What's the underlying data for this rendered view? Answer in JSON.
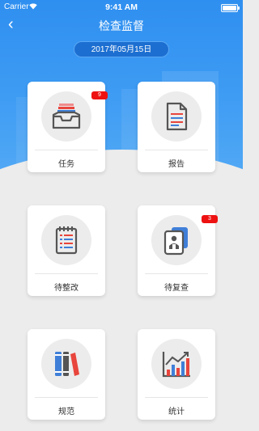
{
  "status_bar": {
    "carrier": "Carrier",
    "wifi_icon": "wifi-icon",
    "time": "9:41 AM",
    "battery_icon": "battery-icon"
  },
  "nav": {
    "back_icon": "chevron-left-icon",
    "back_glyph": "‹",
    "title": "检查监督"
  },
  "date": "2017年05月15日",
  "colors": {
    "header": "#2f8ff0",
    "badge": "#ee1111",
    "accent_red": "#e8453c",
    "accent_blue": "#3f7fd8"
  },
  "cards": [
    {
      "label": "任务",
      "badge": "9",
      "icon": "inbox-tray-icon"
    },
    {
      "label": "报告",
      "badge": "",
      "icon": "report-document-icon"
    },
    {
      "label": "待整改",
      "badge": "",
      "icon": "rectify-notebook-icon"
    },
    {
      "label": "待复查",
      "badge": "3",
      "icon": "review-files-icon"
    },
    {
      "label": "规范",
      "badge": "",
      "icon": "books-icon"
    },
    {
      "label": "统计",
      "badge": "",
      "icon": "statistics-chart-icon"
    }
  ]
}
